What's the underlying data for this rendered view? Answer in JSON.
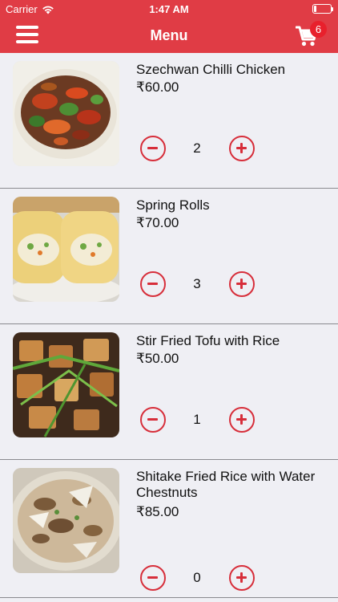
{
  "status_bar": {
    "carrier": "Carrier",
    "time": "1:47 AM",
    "battery_level": 0.1
  },
  "navbar": {
    "title": "Menu",
    "menu_icon": "hamburger-icon",
    "cart_icon": "shopping-cart-icon",
    "cart_count": "6"
  },
  "colors": {
    "brand": "#e03c45",
    "stepper": "#d72e3a",
    "background": "#efeff4"
  },
  "items": [
    {
      "name": "Szechwan Chilli Chicken",
      "price": "₹60.00",
      "quantity": "2",
      "image": "szechwan-chilli-chicken-photo"
    },
    {
      "name": "Spring Rolls",
      "price": "₹70.00",
      "quantity": "3",
      "image": "spring-rolls-photo"
    },
    {
      "name": "Stir Fried Tofu with Rice",
      "price": "₹50.00",
      "quantity": "1",
      "image": "stir-fried-tofu-photo"
    },
    {
      "name": "Shitake Fried Rice with Water Chestnuts",
      "price": "₹85.00",
      "quantity": "0",
      "image": "shitake-fried-rice-photo"
    }
  ]
}
